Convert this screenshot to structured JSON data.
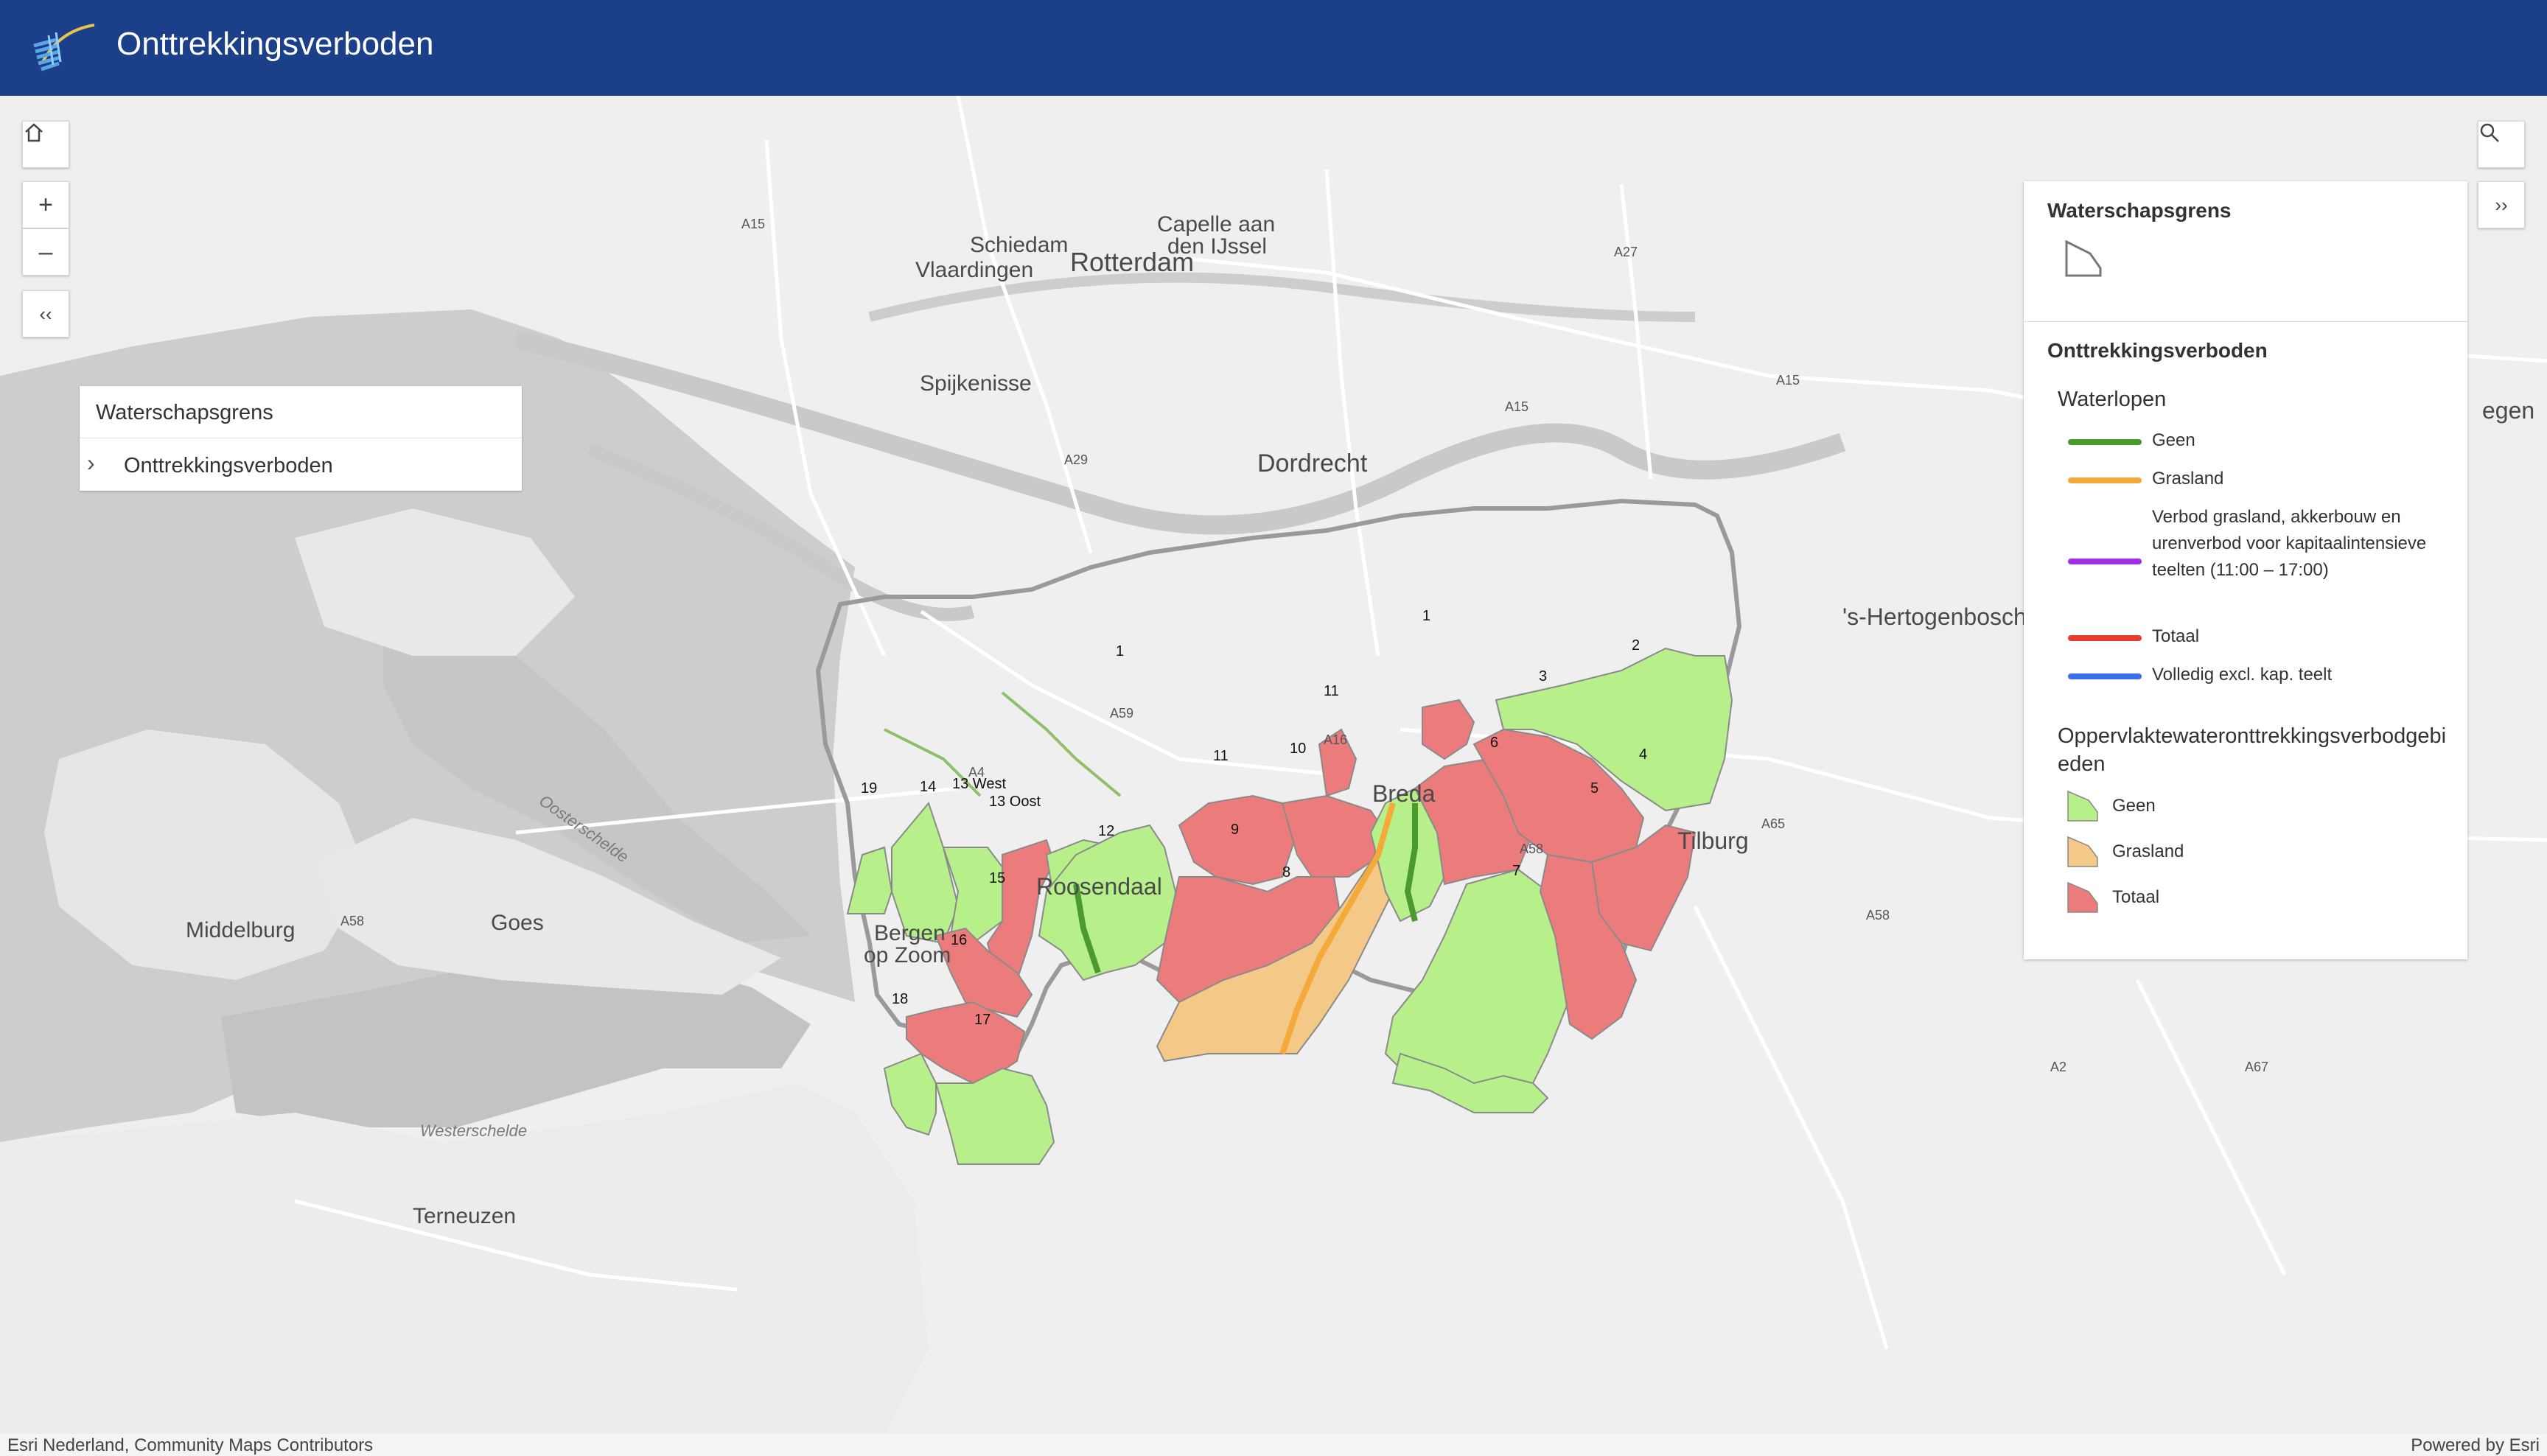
{
  "header": {
    "title": "Onttrekkingsverboden"
  },
  "controls": {
    "home": "⌂",
    "zoom_in": "+",
    "zoom_out": "–",
    "collapse": "‹‹",
    "search": "⚲",
    "expand": "››"
  },
  "layer_list": {
    "items": [
      {
        "label": "Waterschapsgrens",
        "expandable": false
      },
      {
        "label": "Onttrekkingsverboden",
        "expandable": true,
        "chevron": "›"
      }
    ]
  },
  "legend": {
    "layer1": {
      "title": "Waterschapsgrens"
    },
    "layer2": {
      "title": "Onttrekkingsverboden",
      "waterlopen": {
        "title": "Waterlopen",
        "items": [
          {
            "label": "Geen",
            "color": "#4a9a2e"
          },
          {
            "label": "Grasland",
            "color": "#f4a93b"
          },
          {
            "label": "Verbod grasland, akkerbouw en urenverbod voor kapitaalintensieve teelten (11:00 – 17:00)",
            "color": "#a32ee6"
          },
          {
            "label": "Totaal",
            "color": "#e53e2e"
          },
          {
            "label": "Volledig excl. kap. teelt",
            "color": "#3a6fe8"
          }
        ]
      },
      "oppervlakte": {
        "title": "Oppervlaktewateronttrekkingsverbodgebieden",
        "items": [
          {
            "label": "Geen",
            "color": "#b7f08a"
          },
          {
            "label": "Grasland",
            "color": "#f4c987"
          },
          {
            "label": "Totaal",
            "color": "#ec7c7c"
          }
        ]
      }
    }
  },
  "map": {
    "place_labels": [
      "Schiedam",
      "Vlaardingen",
      "Rotterdam",
      "Capelle aan",
      "den IJssel",
      "Spijkenisse",
      "Dordrecht",
      "'s-Hertogenbosch",
      "egen",
      "Breda",
      "Tilburg",
      "Roosendaal",
      "Bergen",
      "op Zoom",
      "Middelburg",
      "Goes",
      "Terneuzen",
      "Oosterschelde",
      "Westerschelde"
    ],
    "road_labels": [
      "A15",
      "A27",
      "A15",
      "A15",
      "A29",
      "A59",
      "A4",
      "A16",
      "A58",
      "A65",
      "A58",
      "A58",
      "A2",
      "A67"
    ],
    "area_labels": [
      "1",
      "1",
      "2",
      "3",
      "4",
      "5",
      "6",
      "7",
      "8",
      "9",
      "10",
      "11",
      "11",
      "12",
      "13 West",
      "13 Oost",
      "14",
      "15",
      "16",
      "17",
      "18",
      "19"
    ],
    "colors": {
      "geen": "#b7f08a",
      "grasland": "#f4c987",
      "totaal": "#ec7c7c",
      "land": "#efefef",
      "water": "#c9c9c9",
      "boundary": "#8f8f8f"
    }
  },
  "attribution": {
    "source": "Esri Nederland, Community Maps Contributors",
    "powered": "Powered by Esri"
  }
}
